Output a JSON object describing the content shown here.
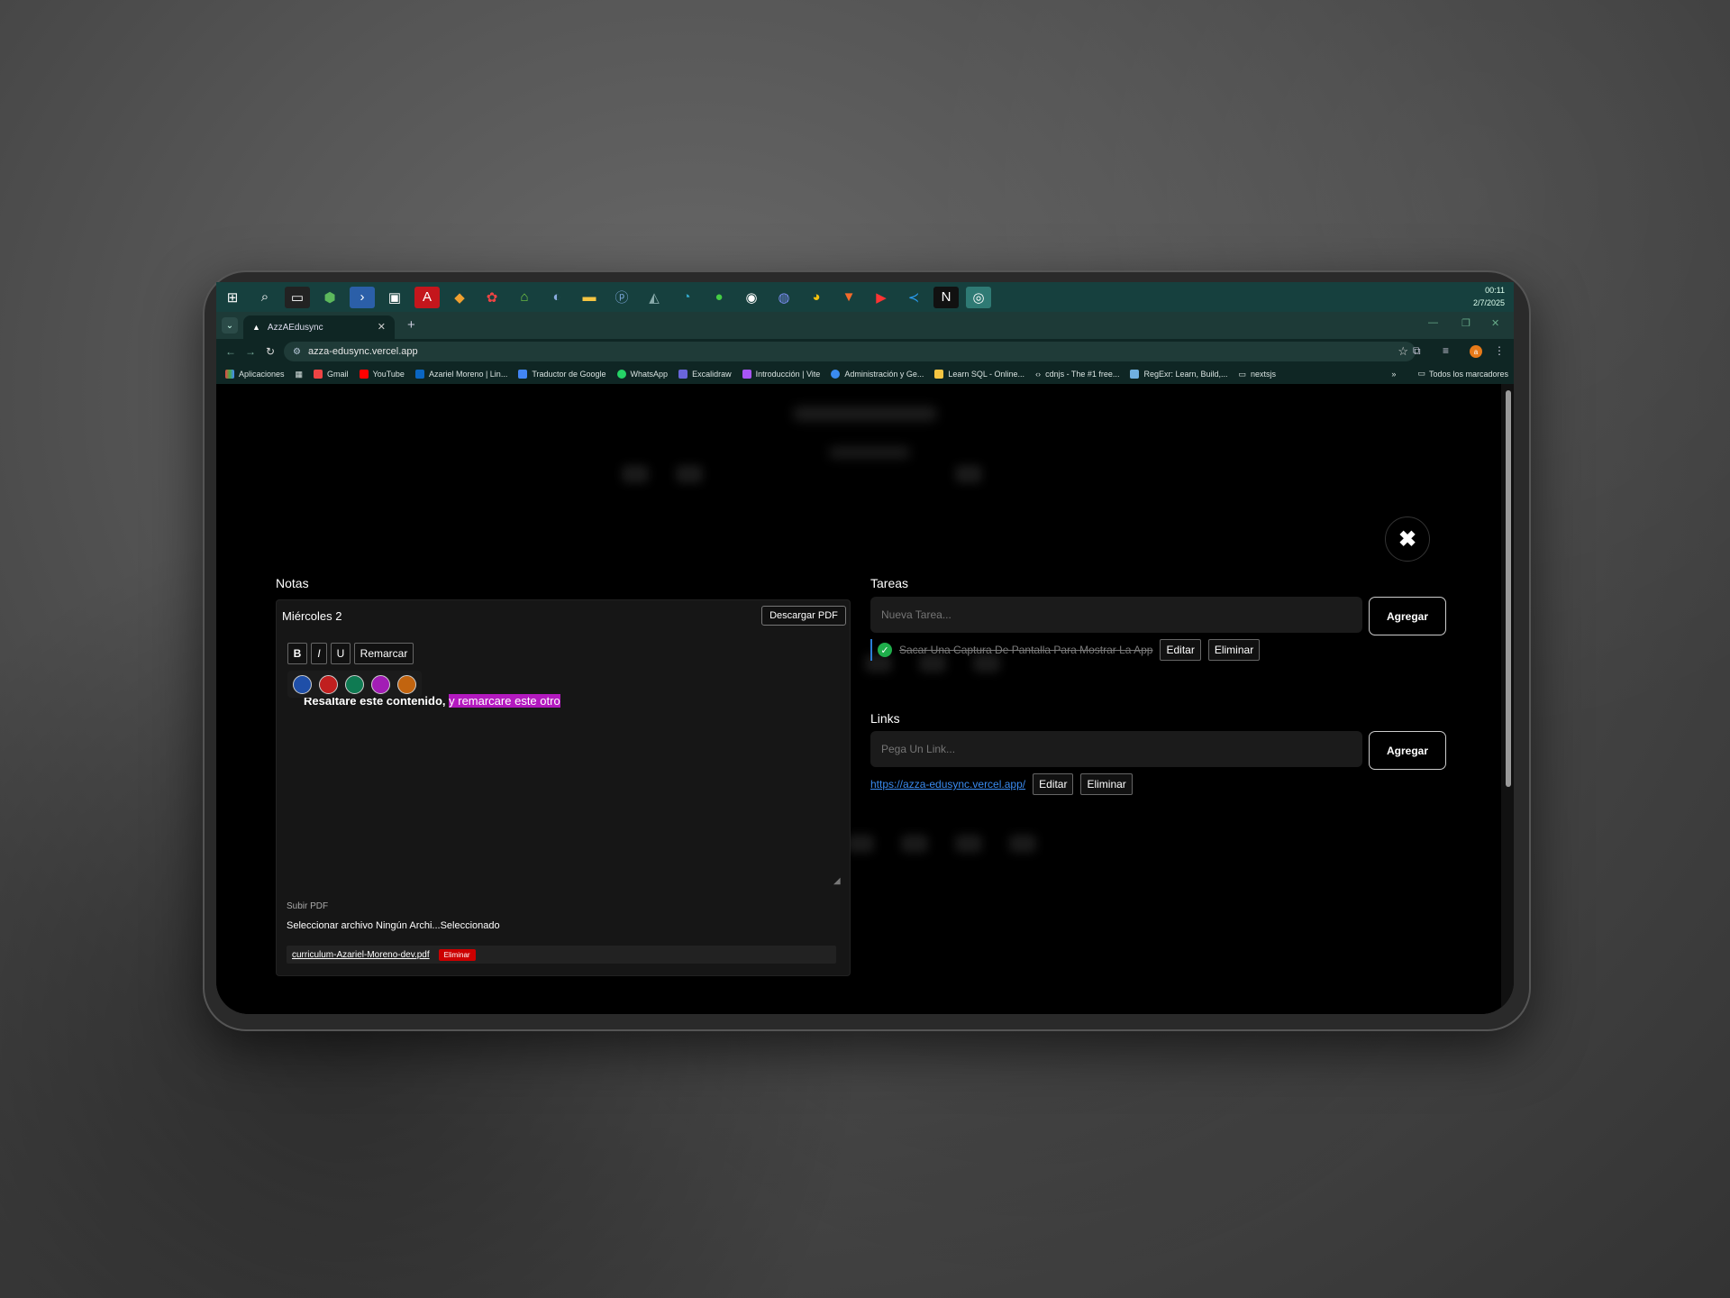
{
  "taskbar": {
    "icons": [
      "windows-start",
      "search",
      "terminal",
      "node",
      "powershell",
      "monitor",
      "acrobat",
      "git",
      "todoist",
      "android-studio",
      "copilot",
      "file-explorer",
      "postgres",
      "dbeaver",
      "edge",
      "mongodb",
      "github",
      "discord",
      "chrome",
      "brave",
      "youtube-music",
      "vscode",
      "notion",
      "obs"
    ],
    "clock_time": "00:11",
    "clock_date": "2/7/2025"
  },
  "browser": {
    "tab_title": "AzzAEdusync",
    "url": "azza-edusync.vercel.app",
    "avatar_letter": "a",
    "bookmarks": [
      "Aplicaciones",
      "Gmail",
      "YouTube",
      "Azariel Moreno | Lin...",
      "Traductor de Google",
      "WhatsApp",
      "Excalidraw",
      "Introducción | Vite",
      "Administración y Ge...",
      "Learn SQL - Online...",
      "cdnjs - The #1 free...",
      "RegExr: Learn, Build,...",
      "nextsjs"
    ],
    "bookmarks_more": "»",
    "all_bookmarks": "Todos los marcadores"
  },
  "modal": {
    "notes": {
      "section_title": "Notas",
      "note_title": "Miércoles 2",
      "download_label": "Descargar PDF",
      "format_buttons": [
        "B",
        "I",
        "U",
        "Remarcar"
      ],
      "palette_colors": [
        "#1f4fa8",
        "#c01f1f",
        "#0f7a52",
        "#a21db5",
        "#c2640f"
      ],
      "content_plain": "Resaltare este contenido, ",
      "content_highlight": "y remarcare este otro",
      "upload_label": "Subir PDF",
      "file_input_text": "Seleccionar archivo Ningún Archi...Seleccionado",
      "file_name": "curriculum-Azariel-Moreno-dev.pdf",
      "file_delete": "Eliminar"
    },
    "tasks": {
      "section_title": "Tareas",
      "input_placeholder": "Nueva Tarea...",
      "add_label": "Agregar",
      "items": [
        {
          "text": "Sacar Una Captura De Pantalla Para Mostrar La App",
          "done": true,
          "edit": "Editar",
          "delete": "Eliminar"
        }
      ]
    },
    "links": {
      "section_title": "Links",
      "input_placeholder": "Pega Un Link...",
      "add_label": "Agregar",
      "items": [
        {
          "url": "https://azza-edusync.vercel.app/",
          "edit": "Editar",
          "delete": "Eliminar"
        }
      ]
    }
  },
  "colors": {
    "highlight": "#b319bf",
    "check": "#1fae4b",
    "link": "#3a8bf0",
    "delete_badge": "#cc0000"
  }
}
